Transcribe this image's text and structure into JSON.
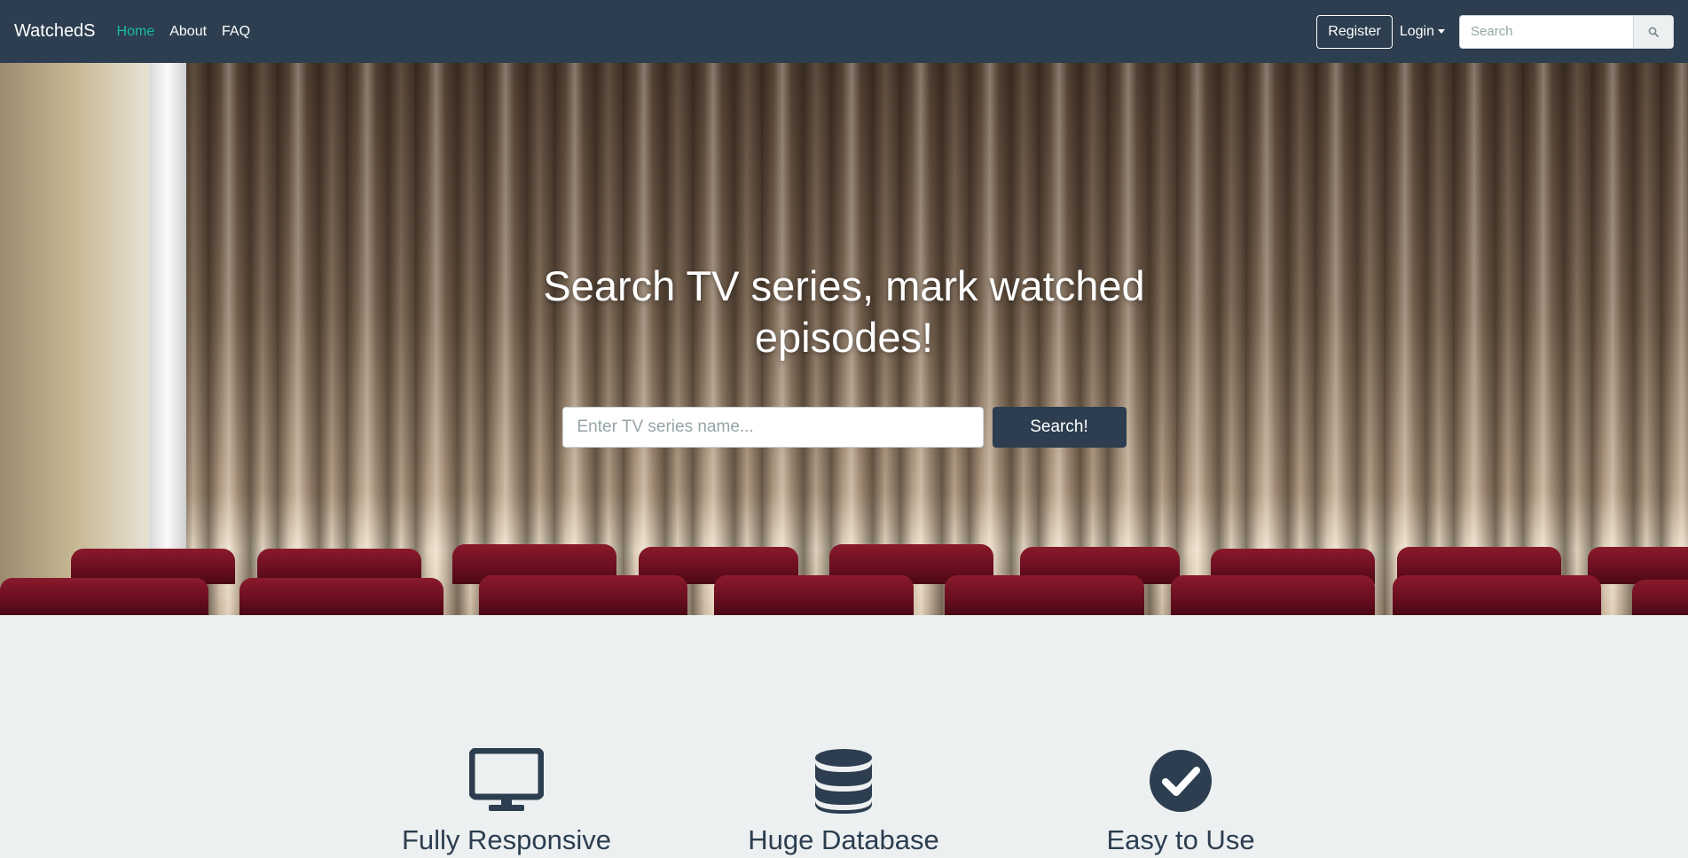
{
  "navbar": {
    "brand": "WatchedS",
    "links": [
      {
        "label": "Home",
        "active": true
      },
      {
        "label": "About",
        "active": false
      },
      {
        "label": "FAQ",
        "active": false
      }
    ],
    "register_label": "Register",
    "login_label": "Login",
    "search_placeholder": "Search",
    "search_icon": "search-icon"
  },
  "hero": {
    "title": "Search TV series, mark watched episodes!",
    "search_placeholder": "Enter TV series name...",
    "search_button": "Search!"
  },
  "features": [
    {
      "icon": "desktop-icon",
      "title": "Fully Responsive"
    },
    {
      "icon": "database-icon",
      "title": "Huge Database"
    },
    {
      "icon": "check-circle-icon",
      "title": "Easy to Use"
    }
  ],
  "colors": {
    "primary": "#2c3e50",
    "accent": "#18bc9c",
    "background": "#ecf0f1"
  }
}
